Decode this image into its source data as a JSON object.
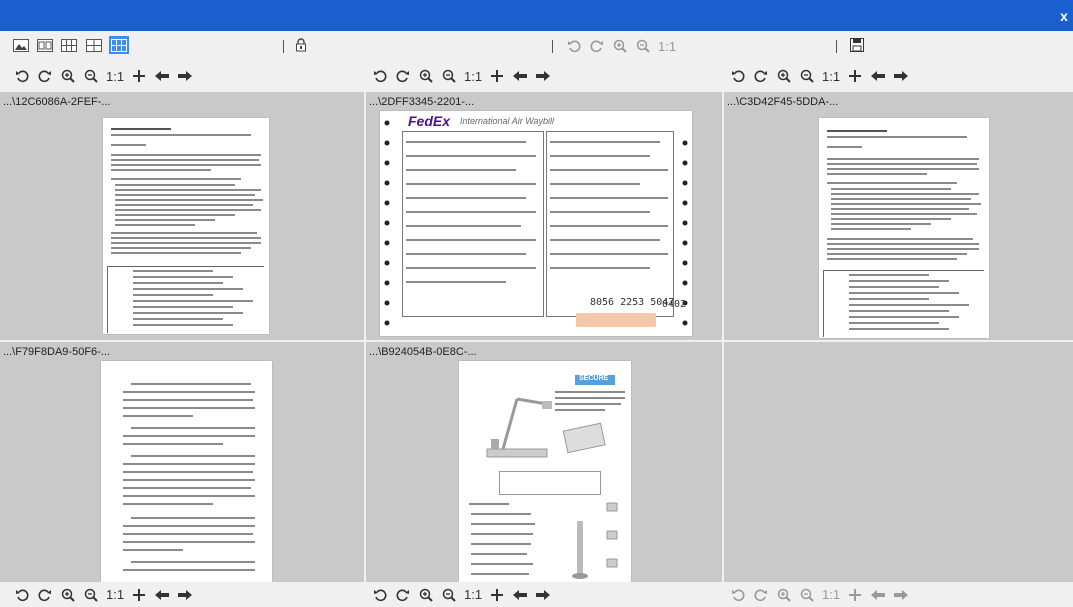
{
  "window": {
    "close_label": "x"
  },
  "top_toolbar": {
    "layout_icons": [
      "single-view-icon",
      "two-view-icon",
      "three-view-icon",
      "four-view-icon",
      "six-view-icon"
    ],
    "zoom_reset_label": "1:1"
  },
  "panel_controls": {
    "zoom_reset_label": "1:1"
  },
  "panels": [
    {
      "path": "...\\12C6086A-2FEF-..."
    },
    {
      "path": "...\\2DFF3345-2201-..."
    },
    {
      "path": "...\\C3D42F45-5DDA-..."
    },
    {
      "path": "...\\F79F8DA9-50F6-..."
    },
    {
      "path": "...\\B924054B-0E8C-..."
    },
    {
      "path": ""
    }
  ],
  "documents": {
    "fedex_logo": "FedEx",
    "fedex_subtitle": "International Air Waybill",
    "fedex_tracking": "8056 2253 5047",
    "fedex_form": "0402",
    "product_badge": "SECURE"
  },
  "colors": {
    "titlebar": "#1a5fd0",
    "panel_bg": "#c9c9c9",
    "selected_layout": "#3d8ee8"
  }
}
